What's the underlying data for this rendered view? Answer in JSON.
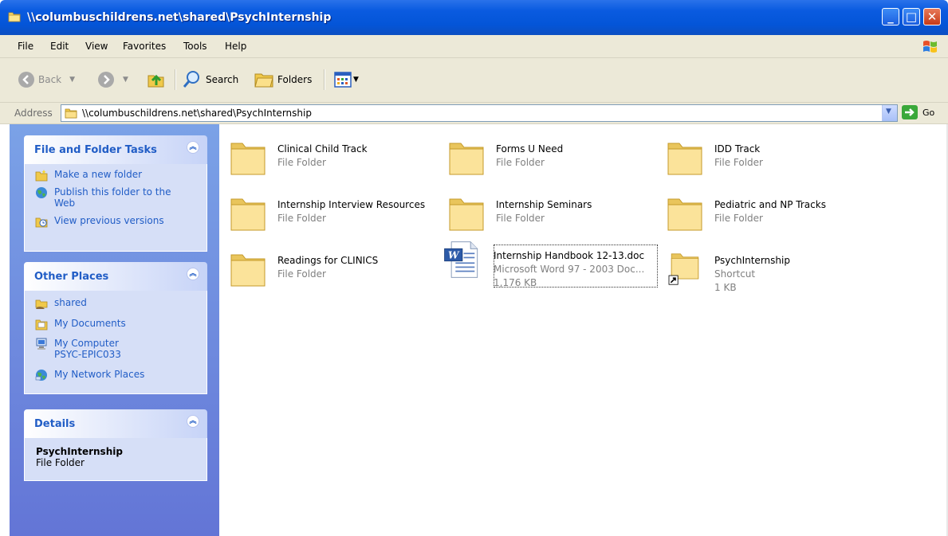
{
  "window": {
    "title": "\\\\columbuschildrens.net\\shared\\PsychInternship"
  },
  "menu": [
    "File",
    "Edit",
    "View",
    "Favorites",
    "Tools",
    "Help"
  ],
  "toolbar": {
    "back": "Back",
    "search": "Search",
    "folders": "Folders"
  },
  "address": {
    "label": "Address",
    "value": "\\\\columbuschildrens.net\\shared\\PsychInternship",
    "go": "Go"
  },
  "left": {
    "tasks": {
      "title": "File and Folder Tasks",
      "items": [
        "Make a new folder",
        "Publish this folder to the Web",
        "View previous versions"
      ]
    },
    "places": {
      "title": "Other Places",
      "items": [
        "shared",
        "My Documents",
        "My Computer PSYC-EPIC033",
        "My Network Places"
      ]
    },
    "details": {
      "title": "Details",
      "name": "PsychInternship",
      "type": "File Folder"
    }
  },
  "files": [
    {
      "name": "Clinical Child Track",
      "type": "File Folder"
    },
    {
      "name": "Forms U Need",
      "type": "File Folder"
    },
    {
      "name": "IDD Track",
      "type": "File Folder"
    },
    {
      "name": "Internship Interview Resources",
      "type": "File Folder"
    },
    {
      "name": "Internship Seminars",
      "type": "File Folder"
    },
    {
      "name": "Pediatric and NP Tracks",
      "type": "File Folder"
    },
    {
      "name": "Readings for CLINICS",
      "type": "File Folder"
    },
    {
      "name": "Internship Handbook 12-13.doc",
      "type": "Microsoft Word 97 - 2003 Doc...",
      "size": "1,176 KB"
    },
    {
      "name": "PsychInternship",
      "type": "Shortcut",
      "size": "1 KB"
    }
  ],
  "colors": {
    "titlebar": "#0455d8",
    "taskpane": "#6375d6",
    "link": "#215dc6"
  }
}
